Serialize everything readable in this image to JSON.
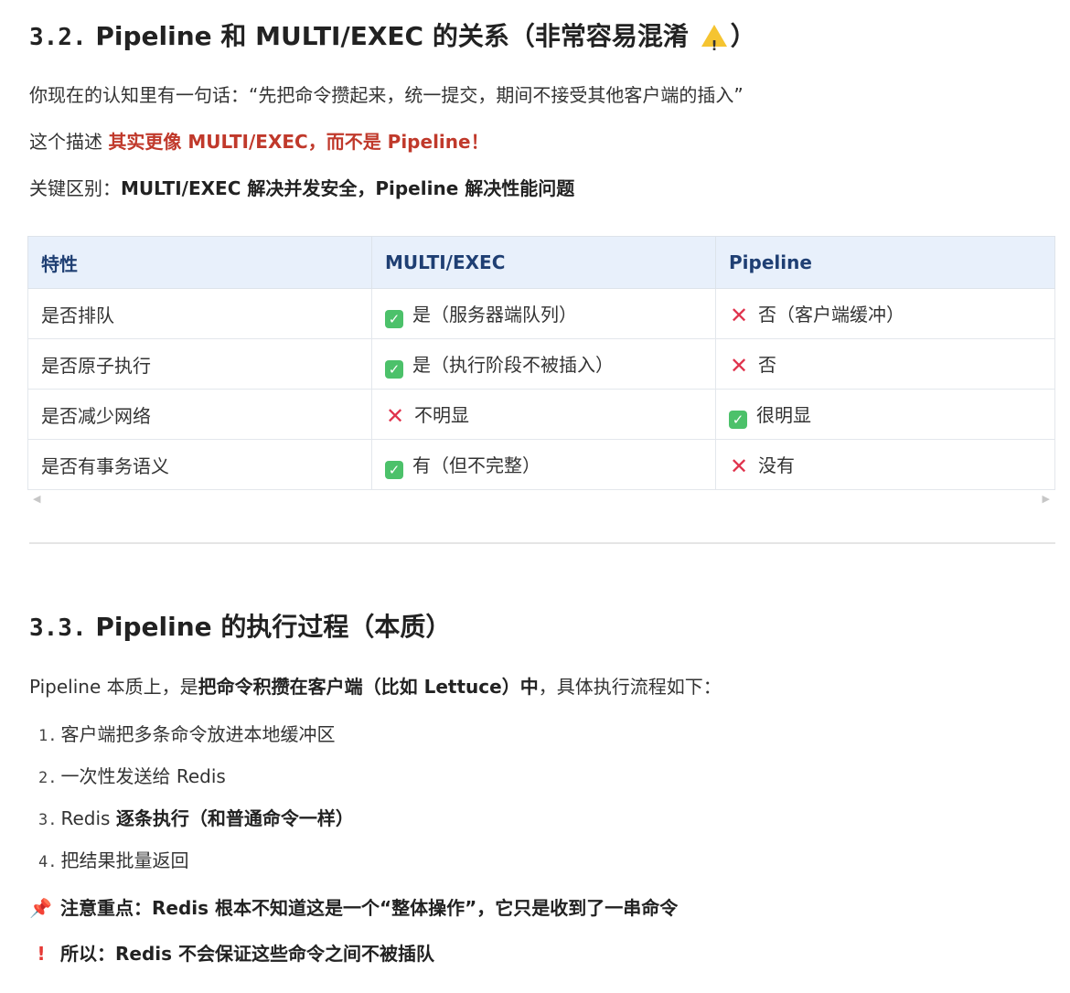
{
  "section1": {
    "num": "3.2.",
    "title": "Pipeline 和 MULTI/EXEC 的关系（非常容易混淆",
    "title_end": "）",
    "p1": "你现在的认知里有一句话：“先把命令攒起来，统一提交，期间不接受其他客户端的插入”",
    "p2_prefix": "这个描述 ",
    "p2_highlight": "其实更像 MULTI/EXEC，而不是 Pipeline！",
    "p3_prefix": "关键区别：",
    "p3_bold": "MULTI/EXEC 解决并发安全，Pipeline 解决性能问题"
  },
  "table": {
    "headers": [
      "特性",
      "MULTI/EXEC",
      "Pipeline"
    ],
    "rows": [
      {
        "feature": "是否排队",
        "multi": "是（服务器端队列）",
        "multi_ok": true,
        "pipe": "否（客户端缓冲）",
        "pipe_ok": false
      },
      {
        "feature": "是否原子执行",
        "multi": "是（执行阶段不被插入）",
        "multi_ok": true,
        "pipe": "否",
        "pipe_ok": false
      },
      {
        "feature": "是否减少网络",
        "multi": "不明显",
        "multi_ok": false,
        "pipe": "很明显",
        "pipe_ok": true
      },
      {
        "feature": "是否有事务语义",
        "multi": "有（但不完整）",
        "multi_ok": true,
        "pipe": "没有",
        "pipe_ok": false
      }
    ]
  },
  "section2": {
    "num": "3.3.",
    "title": "Pipeline 的执行过程（本质）",
    "intro_prefix": "Pipeline 本质上，是",
    "intro_bold": "把命令积攒在客户端（比如 Lettuce）中",
    "intro_suffix": "，具体执行流程如下：",
    "steps": [
      {
        "n": "1.",
        "text": "客户端把多条命令放进本地缓冲区",
        "bold": ""
      },
      {
        "n": "2.",
        "text": "一次性发送给 Redis",
        "bold": ""
      },
      {
        "n": "3.",
        "text": "Redis ",
        "bold": "逐条执行（和普通命令一样）"
      },
      {
        "n": "4.",
        "text": "把结果批量返回",
        "bold": ""
      }
    ],
    "note1": "注意重点：Redis 根本不知道这是一个“整体操作”，它只是收到了一串命令",
    "note2": "所以：Redis 不会保证这些命令之间不被插队"
  },
  "colors": {
    "accent_red": "#c0392b",
    "check_green": "#4cc16a",
    "cross_red": "#e0334d",
    "header_bg": "#e8f0fb"
  }
}
